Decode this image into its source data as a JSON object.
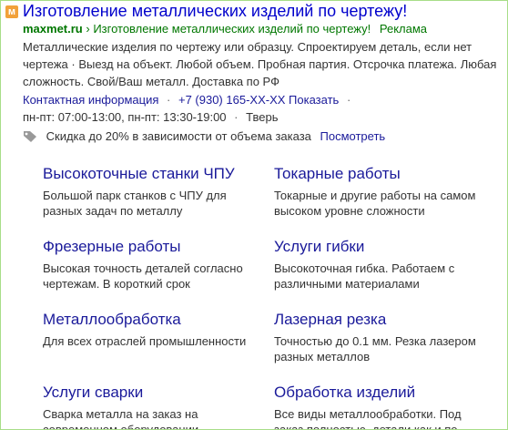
{
  "ad": {
    "favicon_icon": "maxmet-favicon-icon",
    "favicon_letter": "м",
    "title": "Изготовление металлических изделий по чертежу!",
    "domain": "maxmet.ru",
    "breadcrumb": "› Изготовление металлических изделий по чертежу!",
    "ad_label": "Реклама",
    "description": "Металлические изделия по чертежу или образцу. Спроектируем деталь, если нет чертежа · Выезд на объект. Любой объем. Пробная партия. Отсрочка платежа. Любая сложность. Свой/Ваш металл. Доставка по РФ",
    "contact_label": "Контактная информация",
    "phone": "+7 (930) 165-XX-XX",
    "show_label": "Показать",
    "hours": "пн-пт: 07:00-13:00, пн-пт: 13:30-19:00",
    "city": "Тверь",
    "promo_icon": "tag-icon",
    "promo_text": "Скидка до 20% в зависимости от объема заказа",
    "promo_link": "Посмотреть",
    "colors": {
      "title": "#0000cc",
      "url": "#007700",
      "link": "#1a1a9a",
      "text": "#333333",
      "frame": "#a8dd88",
      "favicon": "#f2a13a"
    }
  },
  "sitelinks": [
    {
      "title": "Высокоточные станки ЧПУ",
      "desc": "Большой парк станков с ЧПУ для разных задач по металлу"
    },
    {
      "title": "Токарные работы",
      "desc": "Токарные и другие работы на самом высоком уровне сложности"
    },
    {
      "title": "Фрезерные работы",
      "desc": "Высокая точность деталей согласно чертежам. В короткий срок"
    },
    {
      "title": "Услуги гибки",
      "desc": "Высокоточная гибка. Работаем с различными материалами"
    },
    {
      "title": "Металлообработка",
      "desc": "Для всех отраслей промышленности"
    },
    {
      "title": "Лазерная резка",
      "desc": "Точностью до 0.1 мм. Резка лазером разных металлов"
    },
    {
      "title": "Услуги сварки",
      "desc": "Сварка металла на заказ на современном оборудовании"
    },
    {
      "title": "Обработка изделий",
      "desc": "Все виды металлообработки. Под заказ полностью, детали как и по"
    }
  ]
}
